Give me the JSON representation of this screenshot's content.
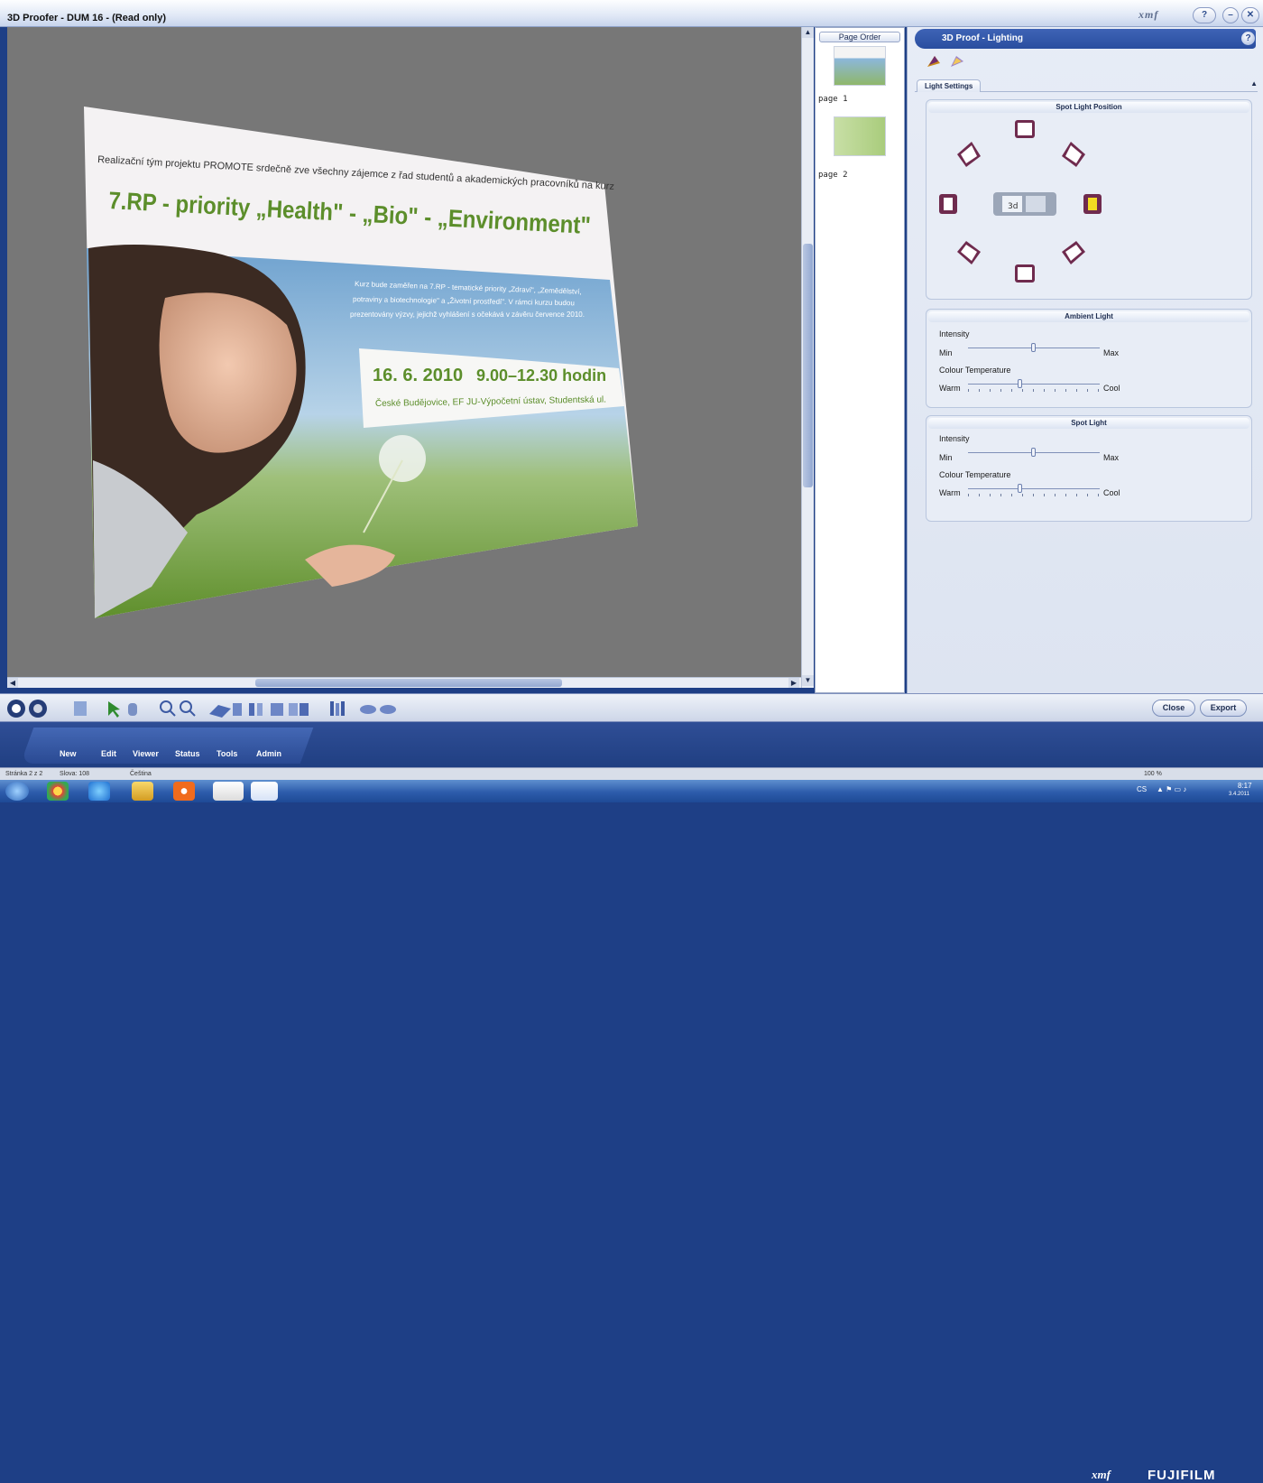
{
  "window": {
    "title": "3D Proofer - DUM 16 - (Read only)",
    "brand_logo": "xmf",
    "help_label": "?"
  },
  "poster": {
    "intro": "Realizační tým projektu PROMOTE srdečně zve všechny zájemce z řad studentů a akademických pracovníků na kurz",
    "headline": "7.RP - priority „Health\" - „Bio\" - „Environment\"",
    "body_line1": "Kurz bude zaměřen na 7.RP - tematické priority „Zdraví\", „Zemědělství,",
    "body_line2": "potraviny a biotechnologie\" a „Životní prostředí\". V rámci kurzu budou",
    "body_line3": "prezentovány výzvy, jejichž vyhlášení s očekává v závěru července 2010.",
    "date": "16. 6. 2010",
    "time": "9.00–12.30 hodin",
    "place": "České Budějovice, EF JU-Výpočetní ústav, Studentská ul."
  },
  "page_order": {
    "header": "Page Order",
    "pages": [
      {
        "label": "page 1"
      },
      {
        "label": "page 2"
      }
    ]
  },
  "lighting_panel": {
    "title": "3D Proof - Lighting",
    "help": "?",
    "tab": "Light Settings",
    "spot_position_title": "Spot Light Position",
    "ambient": {
      "title": "Ambient Light",
      "intensity_label": "Intensity",
      "min": "Min",
      "max": "Max",
      "colour_temp_label": "Colour Temperature",
      "warm": "Warm",
      "cool": "Cool",
      "intensity_value": 0.5,
      "colour_temp_value": 0.4
    },
    "spot": {
      "title": "Spot Light",
      "intensity_label": "Intensity",
      "min": "Min",
      "max": "Max",
      "colour_temp_label": "Colour Temperature",
      "warm": "Warm",
      "cool": "Cool",
      "intensity_value": 0.5,
      "colour_temp_value": 0.4
    }
  },
  "bottom_toolbar": {
    "close": "Close",
    "export": "Export"
  },
  "menu": {
    "items": [
      "New",
      "Edit",
      "Viewer",
      "Status",
      "Tools",
      "Admin"
    ]
  },
  "brand": {
    "xmf": "xmf",
    "fujifilm": "FUJIFILM"
  },
  "statusbar": {
    "page": "Stránka 2 z 2",
    "words": "Slova: 108",
    "language": "Čeština",
    "zoom": "100 %"
  },
  "taskbar": {
    "lang": "CS",
    "time": "8:17",
    "date": "3.4.2011"
  }
}
